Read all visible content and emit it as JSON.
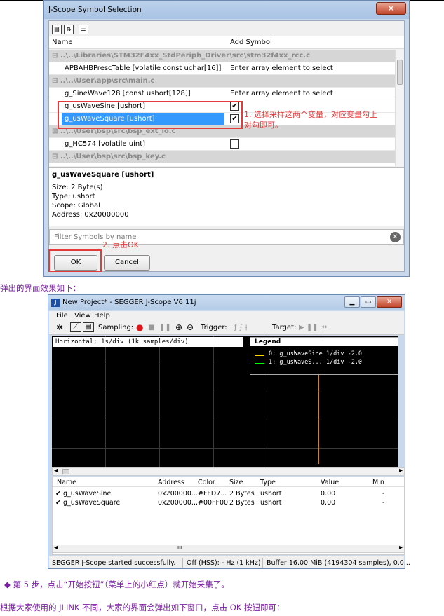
{
  "dialog1": {
    "title": "J-Scope Symbol Selection",
    "close_glyph": "✕",
    "toolbar_icons": [
      "expand-icon",
      "sort-icon",
      "view-icon"
    ],
    "col_name": "Name",
    "col_add": "Add Symbol",
    "rows": [
      {
        "type": "group",
        "name": "⊟ ..\\..\\Libraries\\STM32F4xx_StdPeriph_Driver\\src\\stm32f4xx_rcc.c"
      },
      {
        "type": "item",
        "name": "APBAHBPrescTable [volatile const uchar[16]]",
        "add": "Enter array element to select"
      },
      {
        "type": "group",
        "name": "⊟ ..\\..\\User\\app\\src\\main.c"
      },
      {
        "type": "item",
        "name": "g_SineWave128 [const ushort[128]]",
        "add": "Enter array element to select"
      },
      {
        "type": "item",
        "name": "g_usWaveSine [ushort]",
        "checked": true
      },
      {
        "type": "item",
        "name": "g_usWaveSquare [ushort]",
        "checked": true,
        "selected": true
      },
      {
        "type": "group",
        "name": "⊟ ..\\..\\User\\bsp\\src\\bsp_ext_io.c"
      },
      {
        "type": "item",
        "name": "g_HC574 [volatile uint]",
        "checked": false
      },
      {
        "type": "group",
        "name": "⊟ ..\\..\\User\\bsp\\src\\bsp_key.c"
      }
    ],
    "check_mark": "✔",
    "annotation1_line1": "1. 选择采样这两个变量，对应变量勾上",
    "annotation1_line2": "对勾即可。",
    "info": {
      "name": "g_usWaveSquare [ushort]",
      "size": "Size:  2 Byte(s)",
      "type": "Type:  ushort",
      "scope": "Scope:  Global",
      "address": "Address: 0x20000000"
    },
    "filter_placeholder": "Filter Symbols by name",
    "clear_glyph": "✕",
    "annotation2": "2. 点击OK",
    "ok_label": "OK",
    "cancel_label": "Cancel"
  },
  "caption1": "弹出的界面效果如下：",
  "window2": {
    "app_icon_text": "J",
    "title": "New Project* - SEGGER J-Scope V6.11j",
    "btn_min": "▁",
    "btn_max": "▭",
    "btn_close": "✕",
    "menu": [
      "File",
      "View",
      "Help"
    ],
    "toolbar": {
      "settings_glyph": "✲",
      "sampling_label": "Sampling:",
      "record_glyph": "●",
      "stop_glyph": "■",
      "pause_glyph": "❚❚",
      "zoom_in_glyph": "⊕",
      "zoom_out_glyph": "⊖",
      "trigger_label": "Trigger:",
      "trigger_glyphs": "ƒ  ⨍  ⫲",
      "target_label": "Target:",
      "target_glyphs": "▶  ❚❚  ⏮"
    },
    "horizontal_label": "Horizontal: 1s/div (1k samples/div)",
    "legend_title": "Legend",
    "legend": [
      {
        "text": "0: g_usWaveSine      1/div -2.0",
        "color": "#FFD700"
      },
      {
        "text": "1: g_usWaveS...      1/div -2.0",
        "color": "#00FF00"
      }
    ],
    "scroll_left": "◂",
    "scroll_right": "▸",
    "columns": [
      "Name",
      "Address",
      "Color",
      "Size",
      "Type",
      "Value",
      "Min"
    ],
    "table_rows": [
      {
        "name": "✔ g_usWaveSine",
        "address": "0x200000...",
        "color": "#FFD7...",
        "size": "2 Bytes",
        "type": "ushort",
        "value": "0.00",
        "min": "-"
      },
      {
        "name": "✔ g_usWaveSquare",
        "address": "0x200000...",
        "color": "#00FF00",
        "size": "2 Bytes",
        "type": "ushort",
        "value": "0.00",
        "min": "-"
      }
    ],
    "hscroll_thumb": "III",
    "status": {
      "msg": "SEGGER J-Scope started successfully.",
      "hss": "Off (HSS): - Hz (1 kHz)",
      "buffer": "Buffer 16.00 MiB (4194304 samples), 0.0..."
    }
  },
  "step5": "◆  第 5 步，点击“开始按钮”（菜单上的小红点）就开始采集了。",
  "footer": "根据大家使用的 JLINK 不同，大家的界面会弹出如下窗口，点击 OK 按钮即可："
}
